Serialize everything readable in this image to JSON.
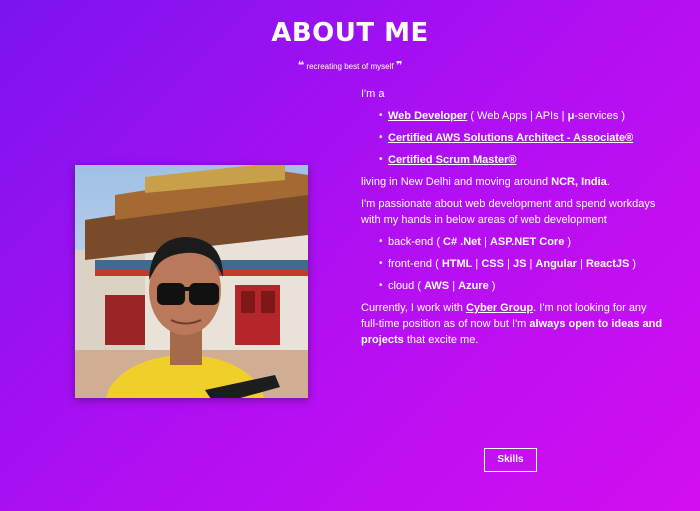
{
  "header": {
    "title": "ABOUT ME",
    "quote_open": "❝",
    "tagline": "recreating best of myself",
    "quote_close": "❞"
  },
  "photo": {
    "alt": "profile photo"
  },
  "about": {
    "intro": "I'm a",
    "roles": [
      {
        "link": "Web Developer",
        "detail_open": " ( Web Apps | APIs | ",
        "micro": "μ",
        "detail_close": "-services )"
      },
      {
        "link": "Certified AWS Solutions Architect - Associate®"
      },
      {
        "link": "Certified Scrum Master®"
      }
    ],
    "location_prefix": "living in New Delhi and moving around ",
    "location_bold": "NCR, India",
    "location_suffix": ".",
    "passion": "I'm passionate about web development and spend workdays with my hands in below areas of web development",
    "skills": [
      {
        "label": "back-end",
        "items": [
          "C# .Net",
          "ASP.NET Core"
        ]
      },
      {
        "label": "front-end",
        "items": [
          "HTML",
          "CSS",
          "JS",
          "Angular",
          "ReactJS"
        ]
      },
      {
        "label": "cloud",
        "items": [
          "AWS",
          "Azure"
        ]
      }
    ],
    "current_prefix": "Currently, I work with ",
    "company": "Cyber Group",
    "current_middle": ". I'm not looking for any full-time position as of now but I'm ",
    "current_bold": "always open to ideas and projects",
    "current_suffix": " that excite me."
  },
  "buttons": {
    "skills": "Skills"
  }
}
